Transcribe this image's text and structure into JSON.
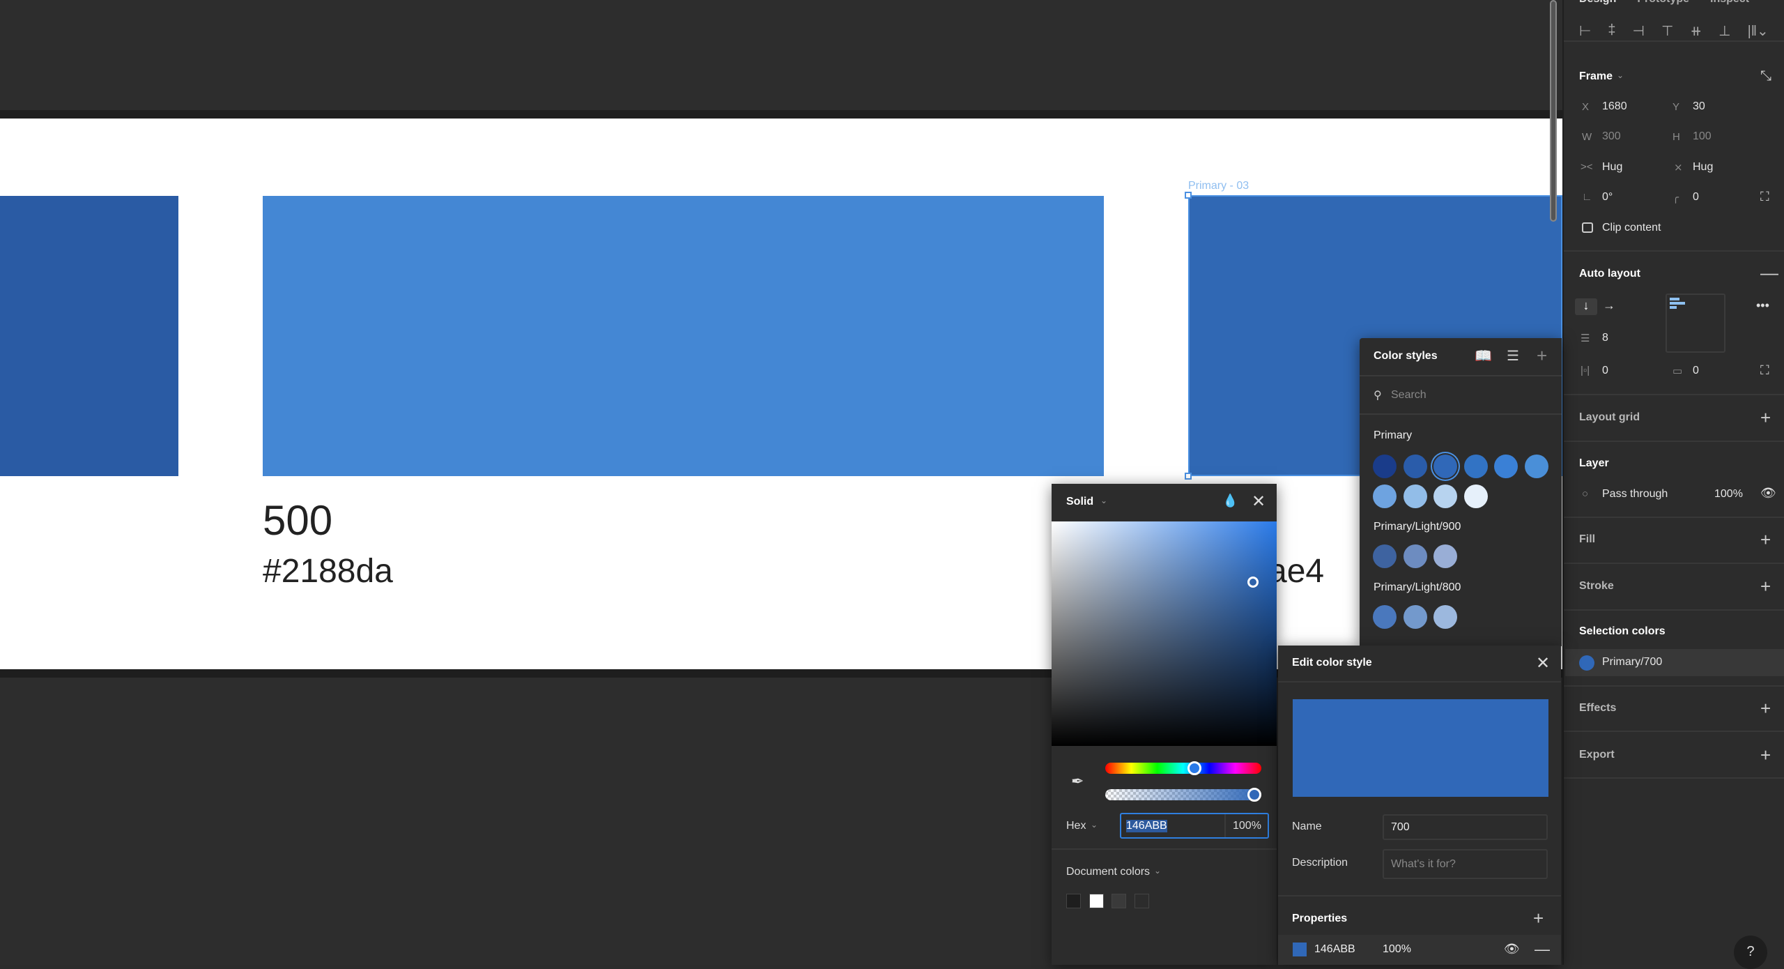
{
  "canvas": {
    "frame_label": "Primary - 03",
    "swatch_title": "500",
    "swatch_hex": "#2188da",
    "partial_hex": "ae4",
    "colors": {
      "left": "#2a5ba4",
      "middle": "#4487d4",
      "selected": "#3068b4"
    }
  },
  "panel": {
    "tabs": [
      "Design",
      "Prototype",
      "Inspect"
    ],
    "frame": {
      "title": "Frame",
      "x_label": "X",
      "x": "1680",
      "y_label": "Y",
      "y": "30",
      "w_label": "W",
      "w": "300",
      "h_label": "H",
      "h": "100",
      "hug_w": "Hug",
      "hug_h": "Hug",
      "rotation": "0°",
      "radius": "0",
      "clip": "Clip content"
    },
    "auto_layout": {
      "title": "Auto layout",
      "spacing": "8",
      "pad_h": "0",
      "pad_v": "0"
    },
    "layout_grid": "Layout grid",
    "layer": {
      "title": "Layer",
      "blend": "Pass through",
      "opacity": "100%"
    },
    "fill": "Fill",
    "stroke": "Stroke",
    "selection_colors": {
      "title": "Selection colors",
      "item": "Primary/700",
      "color": "#3068b8"
    },
    "effects": "Effects",
    "export": "Export",
    "help": "?"
  },
  "color_styles": {
    "title": "Color styles",
    "search_placeholder": "Search",
    "groups": [
      {
        "name": "Primary",
        "swatches": [
          "#1a3c8a",
          "#2a5caa",
          "#3068b8",
          "#3273c4",
          "#3a80d6",
          "#4a8fd8",
          "#6ea3e0",
          "#92bde8",
          "#b7d3ef",
          "#e6f0fa"
        ],
        "selected": 2
      },
      {
        "name": "Primary/Light/900",
        "swatches": [
          "#3e63a0",
          "#6d8cc0",
          "#99aed6"
        ]
      },
      {
        "name": "Primary/Light/800",
        "swatches": [
          "#4a78bd",
          "#7399cc",
          "#9cb8de"
        ]
      }
    ]
  },
  "picker": {
    "mode": "Solid",
    "format": "Hex",
    "hex": "146ABB",
    "opacity": "100%",
    "hue_fraction": 0.58,
    "alpha_fraction": 1.0,
    "document_colors_label": "Document colors",
    "document_colors": [
      "#1e1e1e",
      "#ffffff",
      "#3a3a3a",
      "#2c2c2c"
    ]
  },
  "edit_style": {
    "title": "Edit color style",
    "preview_color": "#3068b8",
    "name_label": "Name",
    "name": "700",
    "description_label": "Description",
    "description_placeholder": "What's it for?",
    "properties_label": "Properties",
    "prop_hex": "146ABB",
    "prop_opacity": "100%"
  }
}
